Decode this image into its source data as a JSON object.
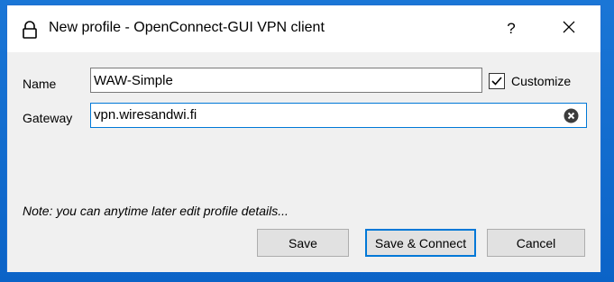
{
  "window": {
    "title": "New profile - OpenConnect-GUI VPN client",
    "help_label": "?",
    "title_icon": "lock-icon",
    "close_icon": "close-icon"
  },
  "form": {
    "name_label": "Name",
    "name_value": "WAW-Simple",
    "customize_label": "Customize",
    "customize_checked": true,
    "gateway_label": "Gateway",
    "gateway_value": "vpn.wiresandwi.fi",
    "clear_icon": "clear-circle-x-icon"
  },
  "note": "Note: you can anytime later edit profile details...",
  "buttons": {
    "save": "Save",
    "save_connect": "Save & Connect",
    "cancel": "Cancel"
  },
  "colors": {
    "accent": "#0078d7",
    "window_bg": "#f0f0f0",
    "desktop": "#0b63c7"
  }
}
